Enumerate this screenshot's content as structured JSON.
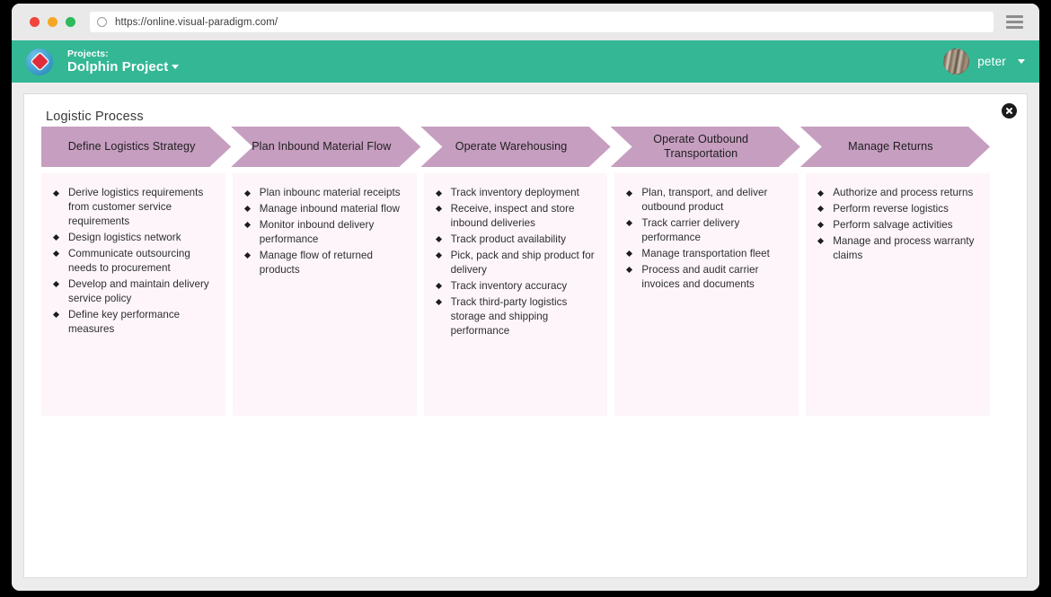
{
  "browser": {
    "url": "https://online.visual-paradigm.com/",
    "reload_icon": "reload-icon",
    "menu_icon": "hamburger-menu-icon",
    "traffic_lights": [
      "close-red",
      "minimize-yellow",
      "maximize-green"
    ]
  },
  "app_header": {
    "logo_icon": "visual-paradigm-globe-logo",
    "projects_label": "Projects:",
    "project_name": "Dolphin Project",
    "project_caret_icon": "chevron-down-icon",
    "user_name": "peter",
    "user_avatar": "user-avatar",
    "user_caret_icon": "chevron-down-icon",
    "accent_color": "#34b795"
  },
  "diagram": {
    "title": "Logistic Process",
    "close_icon": "close-circle-icon",
    "chevron_color": "#c69ec0",
    "column_bg_color": "#fdf5fa",
    "stages": [
      {
        "title": "Define Logistics Strategy",
        "items": [
          "Derive logistics requirements from customer service requirements",
          "Design logistics network",
          "Communicate outsourcing needs to procurement",
          "Develop and maintain delivery service policy",
          "Define key performance measures"
        ]
      },
      {
        "title": "Plan Inbound Material Flow",
        "items": [
          "Plan inbounc material receipts",
          "Manage inbound material flow",
          "Monitor inbound delivery performance",
          "Manage flow of returned products"
        ]
      },
      {
        "title": "Operate Warehousing",
        "items": [
          "Track inventory deployment",
          "Receive, inspect and store inbound deliveries",
          "Track product availability",
          "Pick, pack and ship product for delivery",
          "Track inventory accuracy",
          "Track third-party logistics storage and shipping performance"
        ]
      },
      {
        "title": "Operate Outbound Transportation",
        "items": [
          "Plan, transport, and deliver outbound product",
          "Track carrier delivery performance",
          "Manage transportation fleet",
          "Process and audit carrier invoices and documents"
        ]
      },
      {
        "title": "Manage Returns",
        "items": [
          "Authorize and process returns",
          "Perform reverse logistics",
          "Perform salvage activities",
          "Manage and process warranty claims"
        ]
      }
    ]
  }
}
